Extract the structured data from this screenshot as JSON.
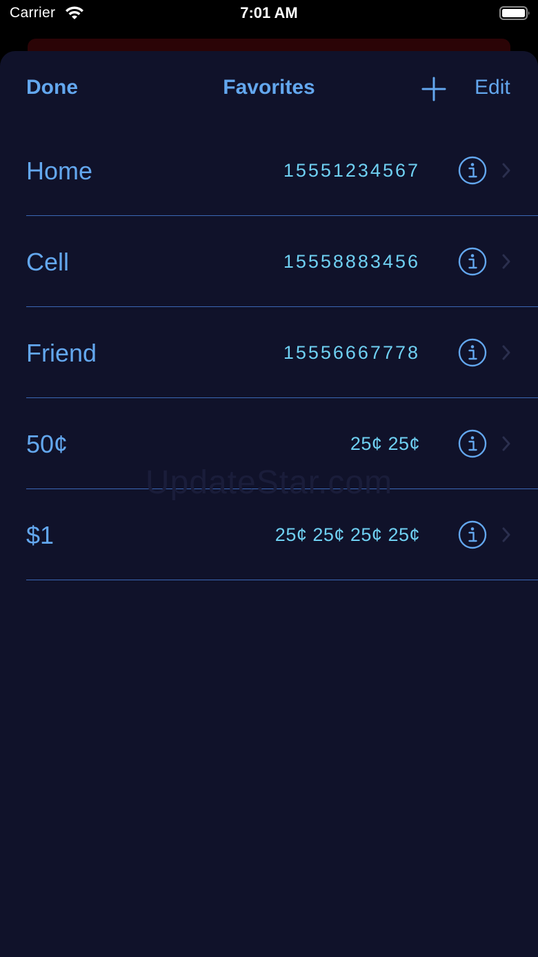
{
  "status_bar": {
    "carrier": "Carrier",
    "time": "7:01 AM"
  },
  "nav": {
    "done_label": "Done",
    "title": "Favorites",
    "add_icon": "plus-icon",
    "edit_label": "Edit"
  },
  "favorites": [
    {
      "name": "Home",
      "detail": "15551234567"
    },
    {
      "name": "Cell",
      "detail": "15558883456"
    },
    {
      "name": "Friend",
      "detail": "15556667778"
    },
    {
      "name": "50¢",
      "detail": "25¢ 25¢"
    },
    {
      "name": "$1",
      "detail": "25¢ 25¢ 25¢ 25¢"
    }
  ],
  "watermark": "UpdateStar.com",
  "colors": {
    "sheet_background": "#10122a",
    "accent": "#63a7ee",
    "detail_text": "#6fd0f2",
    "separator": "#3b68b6"
  }
}
